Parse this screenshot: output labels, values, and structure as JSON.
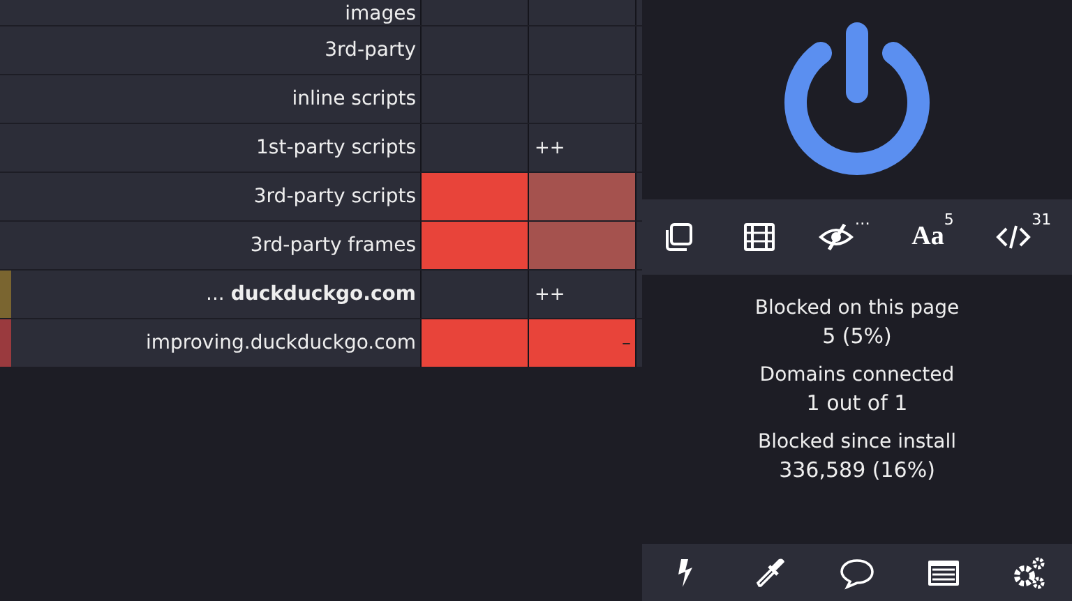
{
  "firewall": {
    "rows": [
      {
        "label": "images",
        "cells": [
          {
            "kind": "empty"
          },
          {
            "kind": "empty"
          }
        ]
      },
      {
        "label": "3rd-party",
        "cells": [
          {
            "kind": "empty"
          },
          {
            "kind": "empty"
          }
        ]
      },
      {
        "label": "inline scripts",
        "cells": [
          {
            "kind": "empty"
          },
          {
            "kind": "empty"
          }
        ]
      },
      {
        "label": "1st-party scripts",
        "cells": [
          {
            "kind": "empty"
          },
          {
            "kind": "empty",
            "text": "++"
          }
        ]
      },
      {
        "label": "3rd-party scripts",
        "cells": [
          {
            "kind": "blocked"
          },
          {
            "kind": "inherited"
          }
        ]
      },
      {
        "label": "3rd-party frames",
        "cells": [
          {
            "kind": "blocked"
          },
          {
            "kind": "inherited"
          }
        ]
      },
      {
        "label": "... **duckduckgo.com**",
        "marker": {
          "color": "#7a6530"
        },
        "cells": [
          {
            "kind": "empty"
          },
          {
            "kind": "empty",
            "text": "++"
          }
        ]
      },
      {
        "label": "improving.duckduckgo.com",
        "marker": {
          "color": "#9a3a3e"
        },
        "cells": [
          {
            "kind": "blocked"
          },
          {
            "kind": "blocked",
            "text": "–"
          }
        ]
      }
    ]
  },
  "tools": [
    {
      "kind": "popup"
    },
    {
      "kind": "media"
    },
    {
      "kind": "cosmetic",
      "badge": "…"
    },
    {
      "kind": "fonts",
      "glyph": "Aa",
      "badge": "5"
    },
    {
      "kind": "scripts",
      "badge": "31"
    }
  ],
  "stats": [
    {
      "label": "Blocked on this page",
      "value": "5 (5%)"
    },
    {
      "label": "Domains connected",
      "value": "1 out of 1"
    },
    {
      "label": "Blocked since install",
      "value": "336,589 (16%)"
    }
  ],
  "bottom_tools": [
    {
      "kind": "zap"
    },
    {
      "kind": "picker"
    },
    {
      "kind": "report"
    },
    {
      "kind": "logger"
    },
    {
      "kind": "settings"
    }
  ]
}
